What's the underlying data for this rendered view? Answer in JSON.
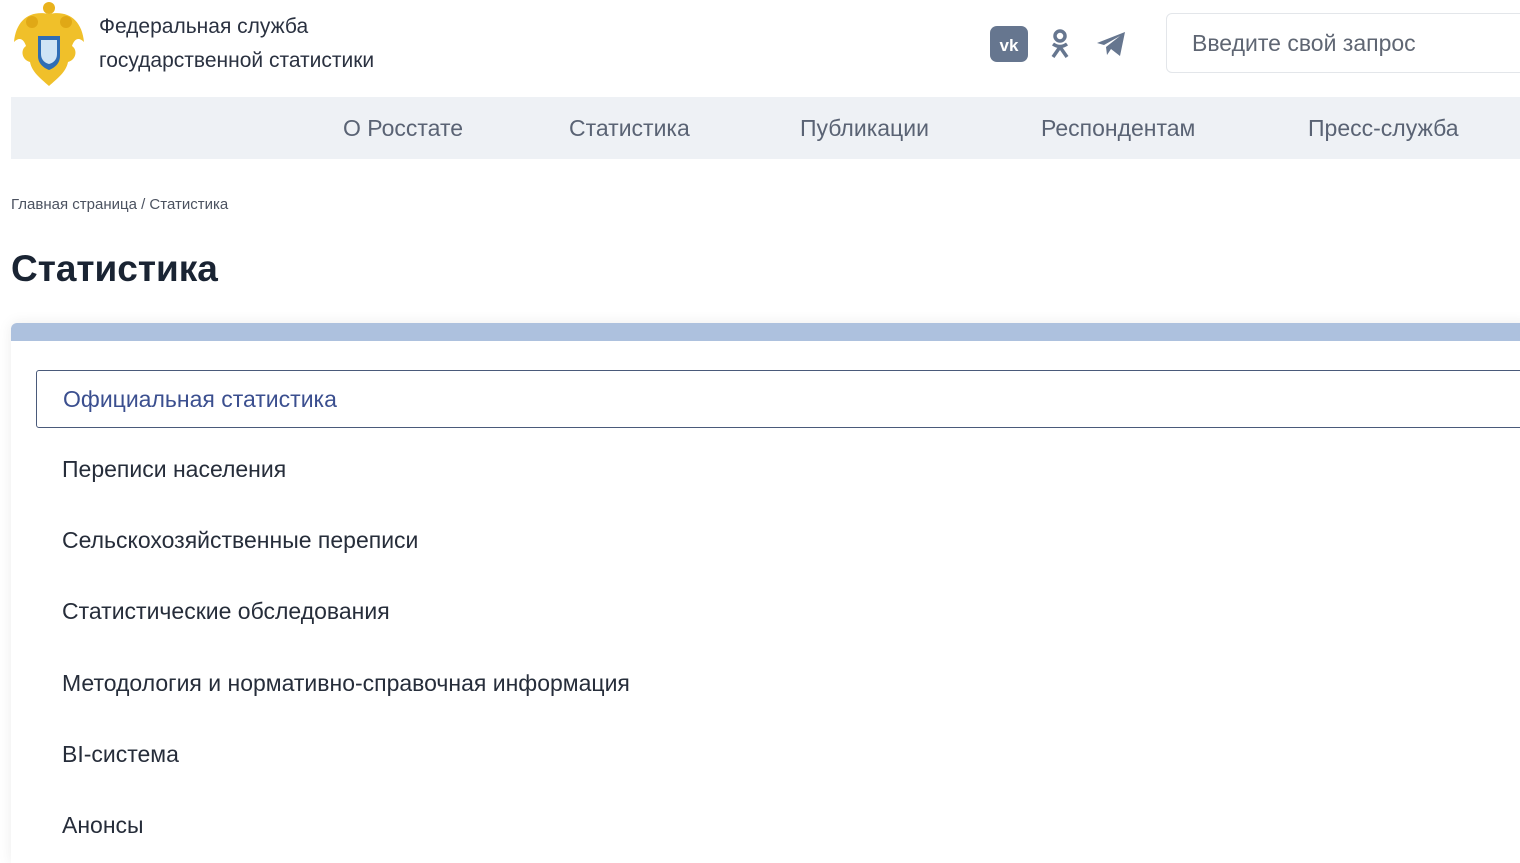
{
  "header": {
    "org_name_line1": "Федеральная служба",
    "org_name_line2": "государственной статистики",
    "search_placeholder": "Введите свой запрос"
  },
  "nav": [
    "О Росстате",
    "Статистика",
    "Публикации",
    "Респондентам",
    "Пресс-служба"
  ],
  "breadcrumb": "Главная страница / Статистика",
  "page_title": "Статистика",
  "menu": [
    "Официальная статистика",
    "Переписи населения",
    "Сельскохозяйственные переписи",
    "Статистические обследования",
    "Методология и нормативно-справочная информация",
    "BI-система",
    "Анонсы"
  ],
  "colors": {
    "accent_bar": "#adc1de",
    "nav_bg": "#eef1f5",
    "active_text": "#3b4f8f"
  }
}
